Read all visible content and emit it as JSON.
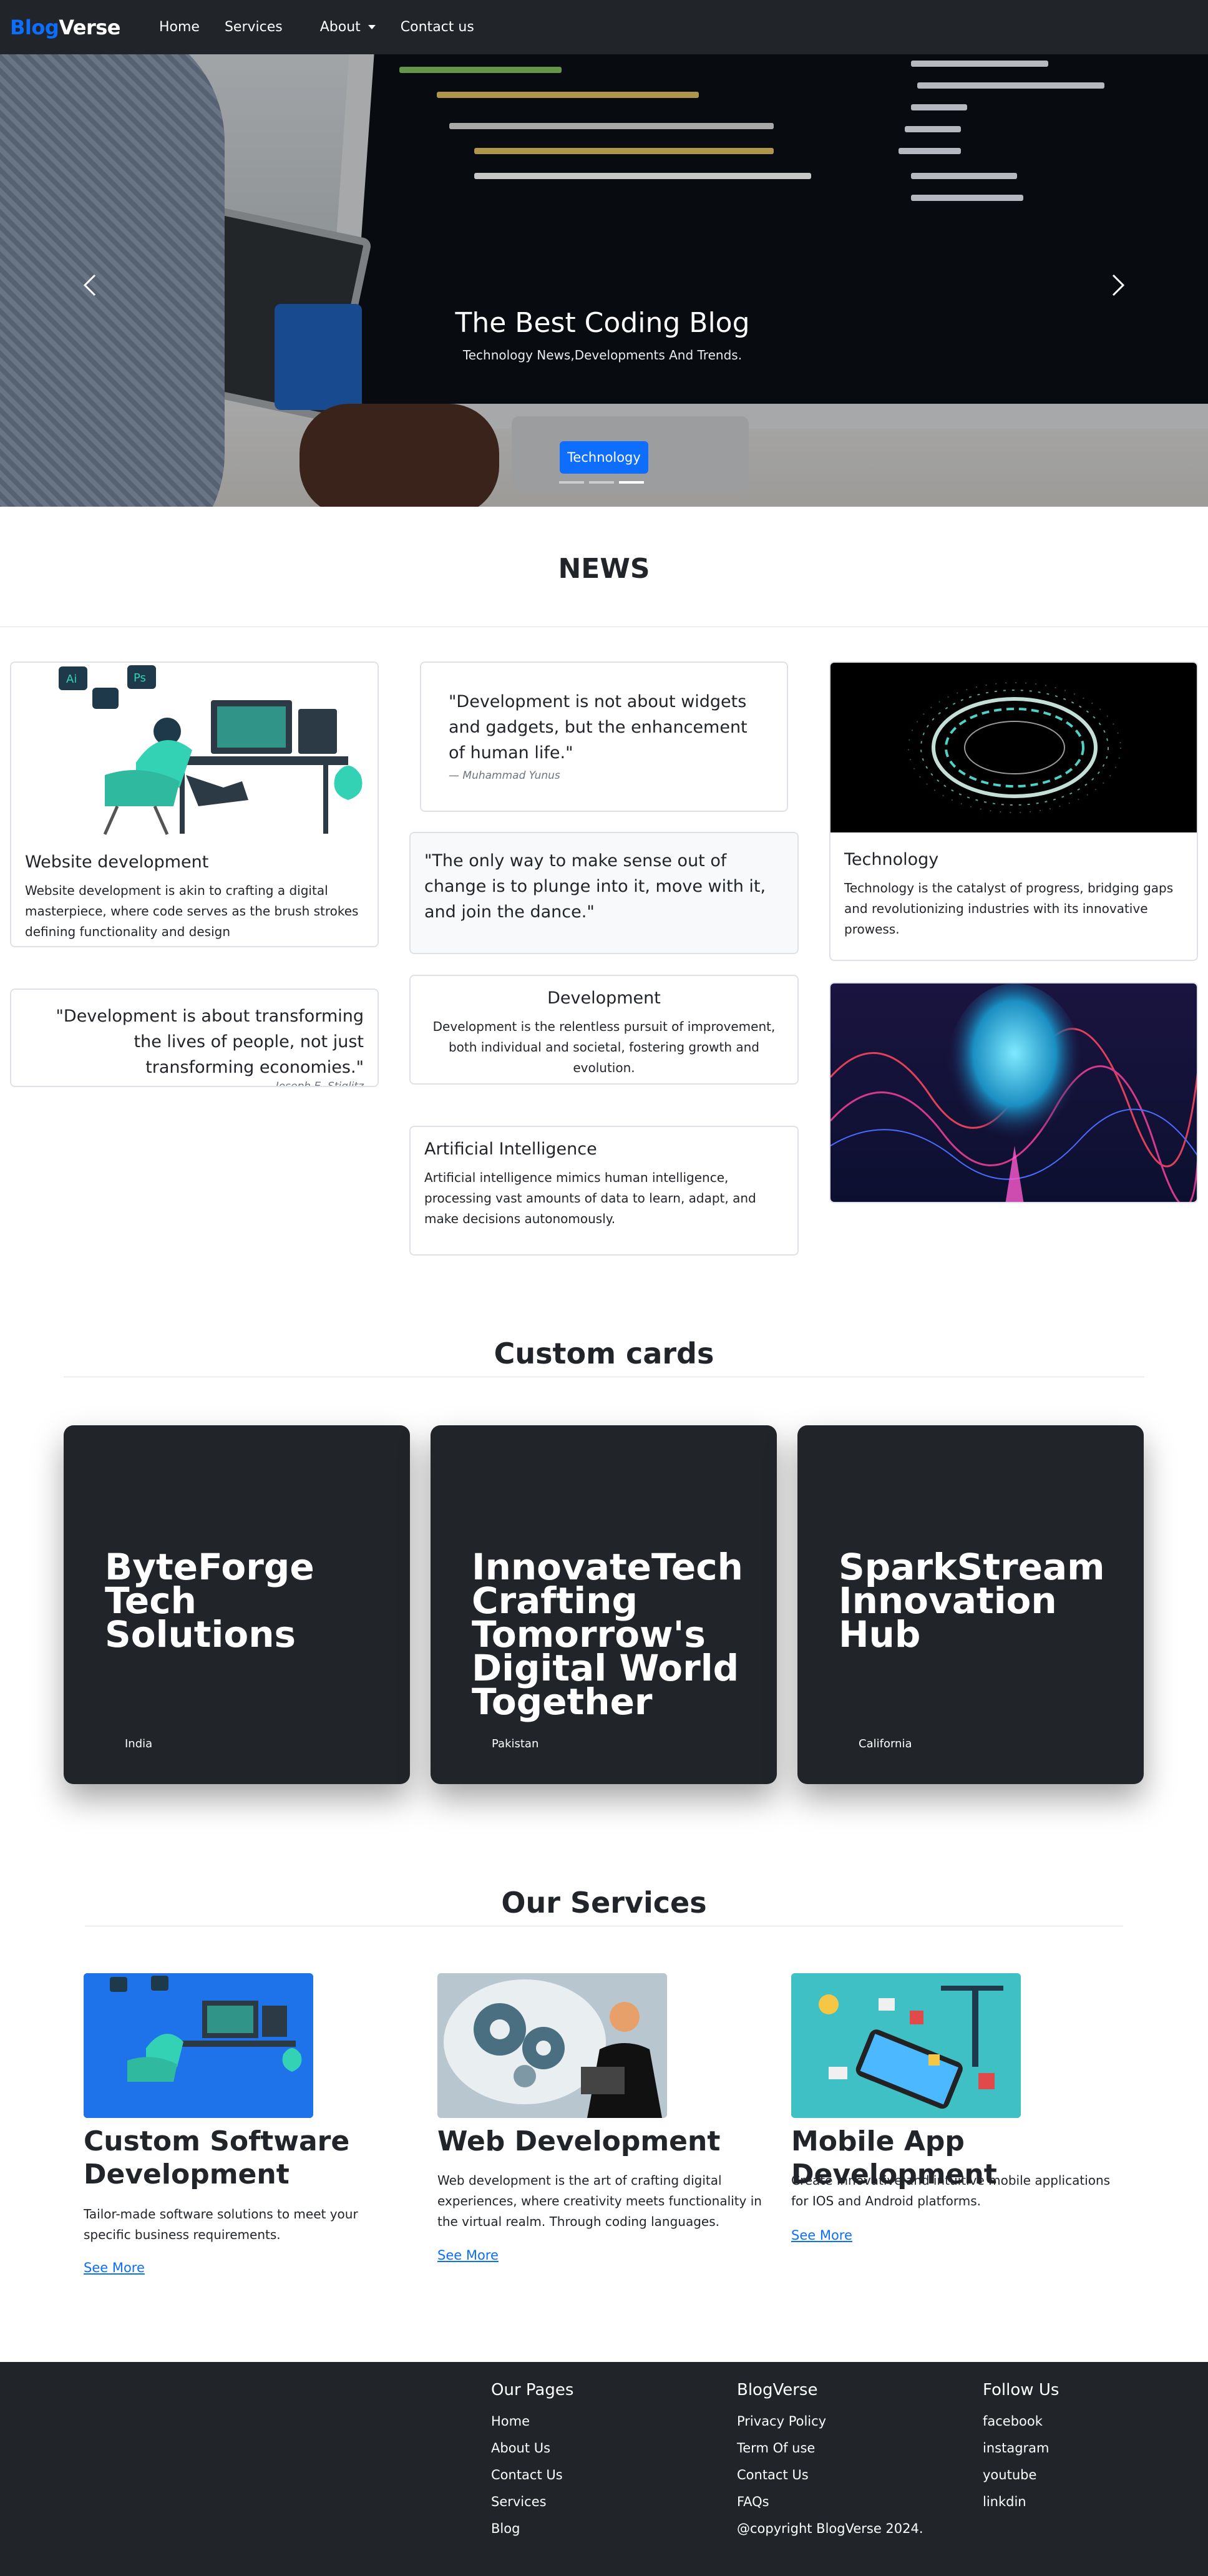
{
  "nav": {
    "brand_part1": "Blog",
    "brand_part2": "Verse",
    "items": [
      "Home",
      "Services",
      "About",
      "Contact us"
    ]
  },
  "hero": {
    "title": "The Best Coding Blog",
    "subtitle": "Technology News,Developments And Trends.",
    "badge": "Technology",
    "slide_count": 3,
    "active_slide": 3
  },
  "news": {
    "heading": "NEWS",
    "website_dev": {
      "title": "Website development",
      "text": "Website development is akin to crafting a digital masterpiece, where code serves as the brush strokes defining functionality and design"
    },
    "quote1": {
      "text": "\"Development is not about widgets and gadgets, but the enhancement of human life.\"",
      "author": "— Muhammad Yunus"
    },
    "quote2": {
      "text": "\"The only way to make sense out of change is to plunge into it, move with it, and join the dance.\""
    },
    "technology": {
      "title": "Technology",
      "text": "Technology is the catalyst of progress, bridging gaps and revolutionizing industries with its innovative prowess."
    },
    "quote3": {
      "text": "\"Development is about transforming the lives of people, not just transforming economies.\"",
      "author": "— Joseph E. Stiglitz"
    },
    "development": {
      "title": "Development",
      "text": "Development is the relentless pursuit of improvement, both individual and societal, fostering growth and evolution."
    },
    "ai": {
      "title": "Artificial Intelligence",
      "text": "Artificial intelligence mimics human intelligence, processing vast amounts of data to learn, adapt, and make decisions autonomously."
    }
  },
  "custom_cards": {
    "heading": "Custom cards",
    "cards": [
      {
        "title": "ByteForge Tech Solutions",
        "location": "India"
      },
      {
        "title": "InnovateTech Crafting Tomorrow's Digital World Together",
        "location": "Pakistan"
      },
      {
        "title": "SparkStream Innovation Hub",
        "location": "California"
      }
    ]
  },
  "services": {
    "heading": "Our Services",
    "items": [
      {
        "title": "Custom Software Development",
        "text": "Tailor-made software solutions to meet your specific business requirements.",
        "link": "See More"
      },
      {
        "title": "Web Development",
        "text": "Web development is the art of crafting digital experiences, where creativity meets functionality in the virtual realm. Through coding languages.",
        "link": "See More"
      },
      {
        "title": "Mobile App Development",
        "text": "Create innovative and intuitive mobile applications for IOS and Android platforms.",
        "link": "See More"
      }
    ]
  },
  "footer": {
    "col1": {
      "heading": "Our Pages",
      "links": [
        "Home",
        "About Us",
        "Contact Us",
        "Services",
        "Blog"
      ]
    },
    "col2": {
      "heading": "BlogVerse",
      "links": [
        "Privacy Policy",
        "Term Of use",
        "Contact Us",
        "FAQs",
        "@copyright BlogVerse 2024."
      ]
    },
    "col3": {
      "heading": "Follow Us",
      "links": [
        "facebook",
        "instagram",
        "youtube",
        "linkdin"
      ]
    }
  },
  "colors": {
    "primary": "#0d6efd",
    "dark": "#212529",
    "border": "#dee2e6"
  }
}
